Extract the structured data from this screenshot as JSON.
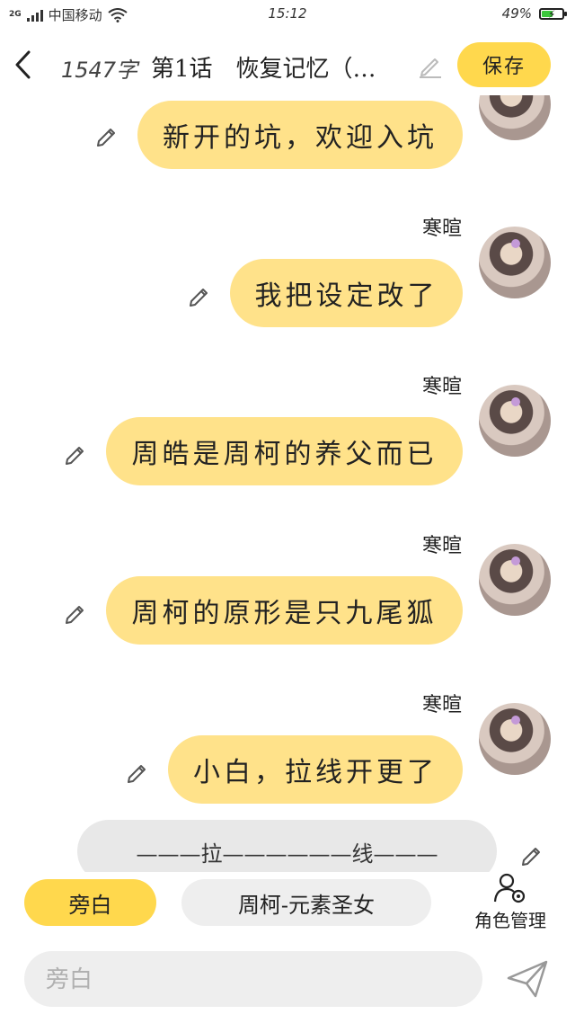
{
  "status_bar": {
    "network": "2G",
    "carrier": "中国移动",
    "time": "15:12",
    "battery": "49%",
    "battery_level": 0.49
  },
  "header": {
    "word_count": "1547字",
    "title": "第1话　恢复记忆（…",
    "save_label": "保存"
  },
  "messages": [
    {
      "speaker": "",
      "text": "新开的坑，欢迎入坑"
    },
    {
      "speaker": "寒暄",
      "text": "我把设定改了"
    },
    {
      "speaker": "寒暄",
      "text": "周皓是周柯的养父而已"
    },
    {
      "speaker": "寒暄",
      "text": "周柯的原形是只九尾狐"
    },
    {
      "speaker": "寒暄",
      "text": "小白，拉线开更了"
    }
  ],
  "narration": {
    "text": "———拉——————线———"
  },
  "roles": {
    "narrator_label": "旁白",
    "character_label": "周柯-元素圣女",
    "manage_label": "角色管理"
  },
  "input": {
    "placeholder": "旁白",
    "value": ""
  },
  "colors": {
    "accent": "#ffd84d",
    "bubble": "#ffe28a",
    "narration_bg": "#e8e8e8",
    "battery": "#3cc83c"
  },
  "icons": {
    "back": "chevron-left-icon",
    "edit": "pencil-icon",
    "manage": "user-gear-icon",
    "send": "send-icon"
  }
}
